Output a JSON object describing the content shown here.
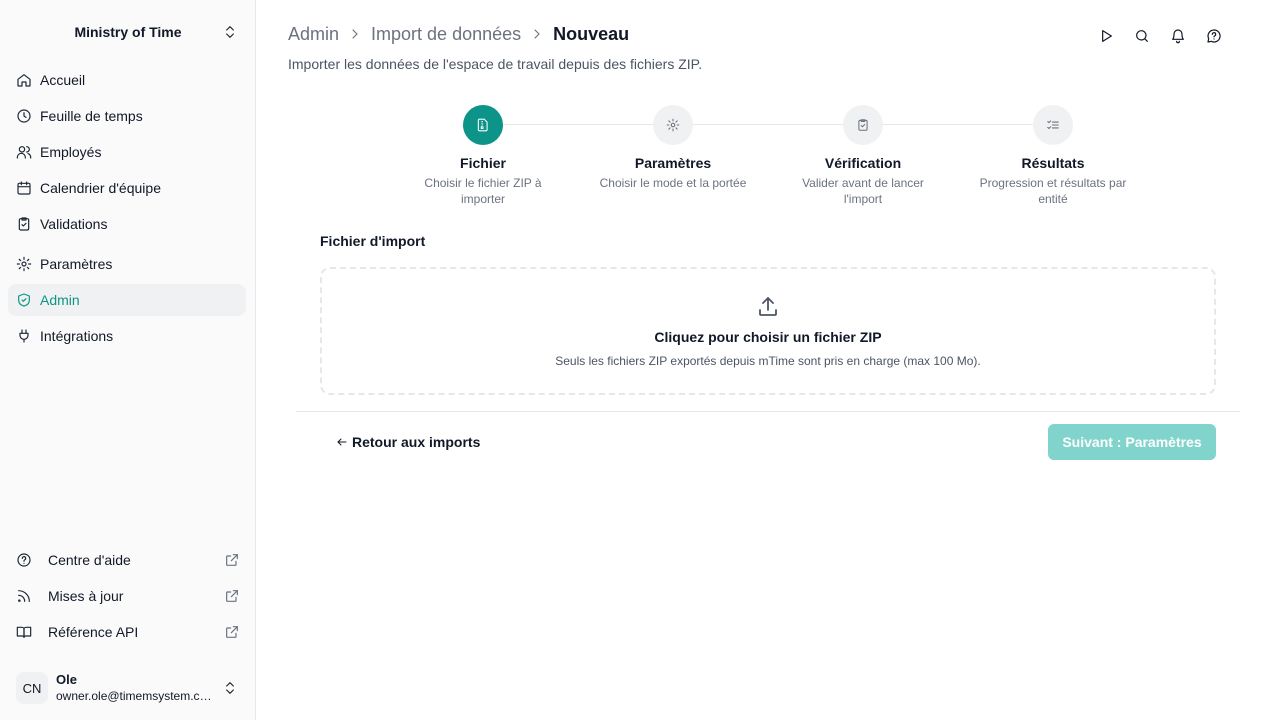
{
  "workspace": {
    "name": "Ministry of Time"
  },
  "sidebar": {
    "items": [
      {
        "label": "Accueil",
        "icon": "home-icon"
      },
      {
        "label": "Feuille de temps",
        "icon": "clock-icon"
      },
      {
        "label": "Employés",
        "icon": "users-icon"
      },
      {
        "label": "Calendrier d'équipe",
        "icon": "calendar-icon"
      },
      {
        "label": "Validations",
        "icon": "clipboard-check-icon"
      },
      {
        "label": "Paramètres",
        "icon": "gear-icon"
      },
      {
        "label": "Admin",
        "icon": "shield-check-icon",
        "active": true
      },
      {
        "label": "Intégrations",
        "icon": "plug-icon"
      }
    ],
    "links": [
      {
        "label": "Centre d'aide",
        "icon": "help-circle-icon"
      },
      {
        "label": "Mises à jour",
        "icon": "rss-icon"
      },
      {
        "label": "Référence API",
        "icon": "book-icon"
      }
    ],
    "user": {
      "initials": "CN",
      "name": "Ole",
      "email": "owner.ole@timemsystem.com"
    }
  },
  "header": {
    "breadcrumb": [
      "Admin",
      "Import de données"
    ],
    "current": "Nouveau",
    "subtitle": "Importer les données de l'espace de travail depuis des fichiers ZIP."
  },
  "steps": [
    {
      "title": "Fichier",
      "desc": "Choisir le fichier ZIP à importer",
      "icon": "file-zip-icon",
      "active": true
    },
    {
      "title": "Paramètres",
      "desc": "Choisir le mode et la portée",
      "icon": "gear-icon"
    },
    {
      "title": "Vérification",
      "desc": "Valider avant de lancer l'import",
      "icon": "clipboard-check-icon"
    },
    {
      "title": "Résultats",
      "desc": "Progression et résultats par entité",
      "icon": "list-checks-icon"
    }
  ],
  "upload": {
    "label": "Fichier d'import",
    "title": "Cliquez pour choisir un fichier ZIP",
    "hint": "Seuls les fichiers ZIP exportés depuis mTime sont pris en charge (max 100 Mo)."
  },
  "actions": {
    "back_label": "Retour aux imports",
    "next_label": "Suivant : Paramètres"
  },
  "colors": {
    "accent": "#0d9488",
    "accent_disabled": "#80d4cc"
  }
}
